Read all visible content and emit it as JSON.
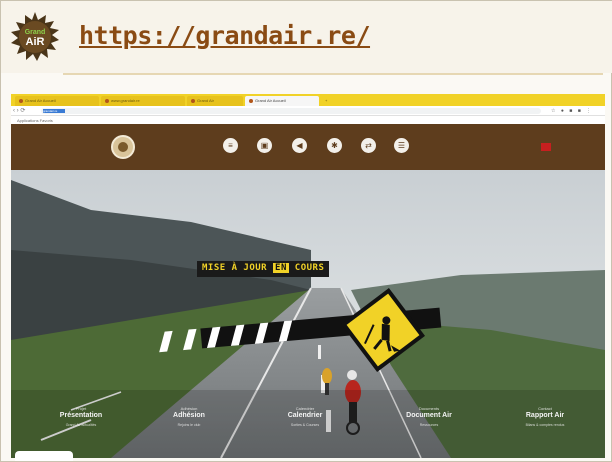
{
  "slide": {
    "url_title": "https://grandair.re/",
    "logo_text_top": "Grand",
    "logo_text_bottom": "AiR"
  },
  "browser": {
    "tabs": [
      "Grand Air Accueil",
      "www.grandair.re",
      "Grand Air",
      "Grand Air Accueil",
      "+"
    ],
    "address": "grandair.re",
    "bookmarks": "Applications   Favoris"
  },
  "site": {
    "nav_icons": [
      "home-icon",
      "calendar-icon",
      "megaphone-icon",
      "bike-icon",
      "document-icon",
      "menu-icon"
    ],
    "flag_color": "#c61f1f",
    "banner": {
      "part1": "MISE À JOUR",
      "part2": "EN",
      "part3": "COURS"
    },
    "bottom_links": [
      {
        "small": "Projet",
        "name": "Présentation",
        "sub": "Grand Air actualités"
      },
      {
        "small": "Adhésion",
        "name": "Adhésion",
        "sub": "Rejoins le club"
      },
      {
        "small": "Calendrier",
        "name": "Calendrier",
        "sub": "Sorties & Courses"
      },
      {
        "small": "Documents",
        "name": "Document Air",
        "sub": "Ressources"
      },
      {
        "small": "Contact",
        "name": "Rapport Air",
        "sub": "Bilans & comptes rendus"
      }
    ]
  },
  "colors": {
    "brand_brown": "#5e3d1d",
    "link_color": "#8a4b14",
    "chrome_yellow": "#f1d227"
  }
}
